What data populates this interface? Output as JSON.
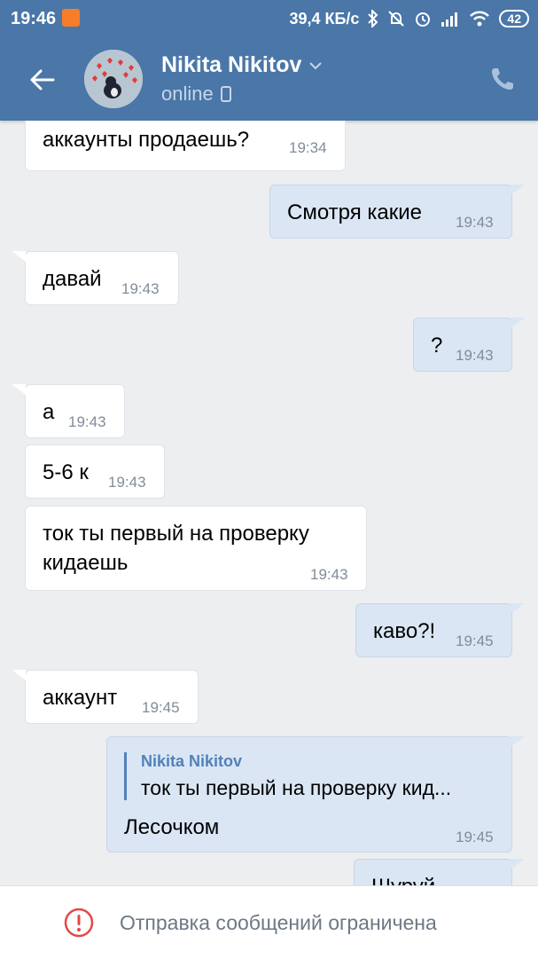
{
  "status_bar": {
    "time": "19:46",
    "speed": "39,4 КБ/с",
    "battery": "42"
  },
  "header": {
    "contact_name": "Nikita Nikitov",
    "status": "online"
  },
  "messages": [
    {
      "dir": "in",
      "text": "аккаунты продаешь?",
      "time": "19:34"
    },
    {
      "dir": "out",
      "text": "Смотря какие",
      "time": "19:43"
    },
    {
      "dir": "in",
      "text": "давай",
      "time": "19:43"
    },
    {
      "dir": "out",
      "text": "?",
      "time": "19:43"
    },
    {
      "dir": "in",
      "text": "а",
      "time": "19:43"
    },
    {
      "dir": "in",
      "text": "5-6 к",
      "time": "19:43"
    },
    {
      "dir": "in",
      "text_line1": "ток ты первый на проверку",
      "text_line2": "кидаешь",
      "time": "19:43"
    },
    {
      "dir": "out",
      "text": "каво?!",
      "time": "19:45"
    },
    {
      "dir": "in",
      "text": "аккаунт",
      "time": "19:45"
    },
    {
      "dir": "out",
      "reply_name": "Nikita Nikitov",
      "reply_text": "ток ты первый на проверку кид...",
      "text": "Лесочком",
      "time": "19:45"
    },
    {
      "dir": "out",
      "text": "Шуруй",
      "time": ""
    }
  ],
  "bottom_bar": {
    "text": "Отправка сообщений ограничена"
  },
  "colors": {
    "header": "#4a76a8",
    "outgoing_bubble": "#dae6f4",
    "incoming_bubble": "#ffffff",
    "background": "#edeef0",
    "warning": "#e64646"
  }
}
